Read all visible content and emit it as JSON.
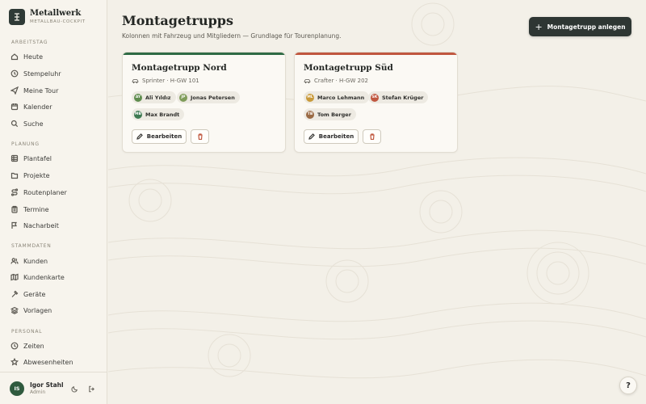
{
  "brand": {
    "title": "Metallwerk",
    "subtitle": "METALLBAU-COCKPIT",
    "logo_icon": "bracket-logo-icon"
  },
  "sidebar": {
    "sections": [
      {
        "label": "ARBEITSTAG",
        "items": [
          {
            "label": "Heute",
            "icon": "home-icon"
          },
          {
            "label": "Stempeluhr",
            "icon": "clock-icon"
          },
          {
            "label": "Meine Tour",
            "icon": "send-icon"
          },
          {
            "label": "Kalender",
            "icon": "calendar-icon"
          },
          {
            "label": "Suche",
            "icon": "search-icon"
          }
        ]
      },
      {
        "label": "PLANUNG",
        "items": [
          {
            "label": "Plantafel",
            "icon": "grid-icon"
          },
          {
            "label": "Projekte",
            "icon": "folder-icon"
          },
          {
            "label": "Routenplaner",
            "icon": "route-icon"
          },
          {
            "label": "Termine",
            "icon": "clipboard-icon"
          },
          {
            "label": "Nacharbeit",
            "icon": "flag-icon"
          }
        ]
      },
      {
        "label": "STAMMDATEN",
        "items": [
          {
            "label": "Kunden",
            "icon": "users-icon"
          },
          {
            "label": "Kundenkarte",
            "icon": "map-icon"
          },
          {
            "label": "Geräte",
            "icon": "hammer-icon"
          },
          {
            "label": "Vorlagen",
            "icon": "layers-icon"
          }
        ]
      },
      {
        "label": "PERSONAL",
        "items": [
          {
            "label": "Zeiten",
            "icon": "clock-icon"
          },
          {
            "label": "Abwesenheiten",
            "icon": "star-icon"
          }
        ]
      }
    ]
  },
  "user": {
    "initials": "IS",
    "name": "Igor Stahl",
    "role": "Admin"
  },
  "page": {
    "title": "Montagetrupps",
    "subtitle": "Kolonnen mit Fahrzeug und Mitgliedern — Grundlage für Tourenplanung.",
    "primary_action": "Montagetrupp anlegen"
  },
  "teams": [
    {
      "name": "Montagetrupp Nord",
      "accent": "#2f6b45",
      "vehicle": "Sprinter · H-GW 101",
      "members": [
        {
          "initials": "AY",
          "name": "Ali Yıldız",
          "color": "#5f8c4e"
        },
        {
          "initials": "JP",
          "name": "Jonas Petersen",
          "color": "#7f9c5a"
        },
        {
          "initials": "MB",
          "name": "Max Brandt",
          "color": "#3e7a52"
        }
      ],
      "edit_label": "Bearbeiten"
    },
    {
      "name": "Montagetrupp Süd",
      "accent": "#c0573f",
      "vehicle": "Crafter · H-GW 202",
      "members": [
        {
          "initials": "ML",
          "name": "Marco Lehmann",
          "color": "#c99a3a"
        },
        {
          "initials": "SK",
          "name": "Stefan Krüger",
          "color": "#c0573f"
        },
        {
          "initials": "TB",
          "name": "Tom Berger",
          "color": "#9a6a44"
        }
      ],
      "edit_label": "Bearbeiten"
    }
  ],
  "help": {
    "label": "?"
  }
}
